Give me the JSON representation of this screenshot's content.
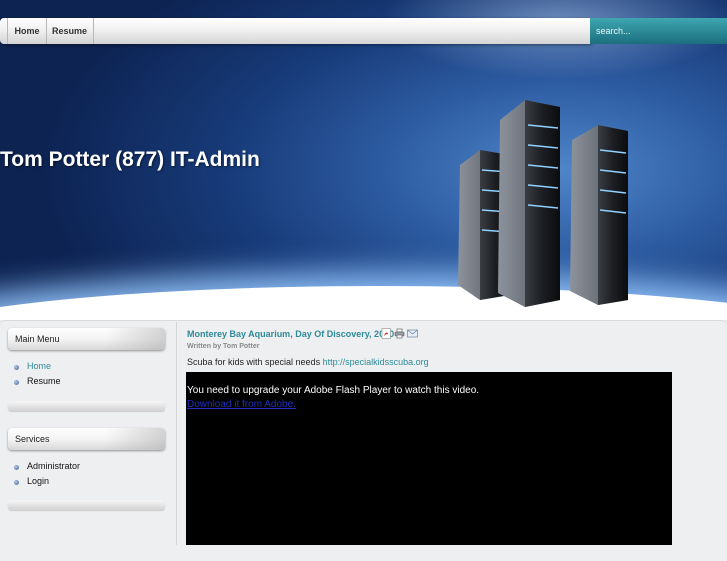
{
  "nav": {
    "items": [
      {
        "label": "Home"
      },
      {
        "label": "Resume"
      }
    ],
    "search_placeholder": "search..."
  },
  "banner": {
    "title": "Tom Potter (877) IT-Admin",
    "image_icon": "server-towers"
  },
  "sidebar": {
    "main_menu": {
      "title": "Main Menu",
      "items": [
        {
          "label": "Home",
          "active": true
        },
        {
          "label": "Resume",
          "active": false
        }
      ]
    },
    "services": {
      "title": "Services",
      "items": [
        {
          "label": "Administrator"
        },
        {
          "label": "Login"
        }
      ]
    }
  },
  "article": {
    "title": "Monterey Bay Aquarium, Day Of Discovery, 2010",
    "icons": [
      "pdf-icon",
      "print-icon",
      "email-icon"
    ],
    "byline": "Written by Tom Potter",
    "intro_text": "Scuba for kids with special needs",
    "intro_link": "http://specialkidsscuba.org",
    "video": {
      "message": "You need to upgrade your Adobe Flash Player to watch this video.",
      "link": "Download it from Adobe."
    }
  },
  "colors": {
    "accent": "#2e8a98",
    "banner_dark": "#0d2352",
    "search_bg": "#1b6f7d"
  }
}
